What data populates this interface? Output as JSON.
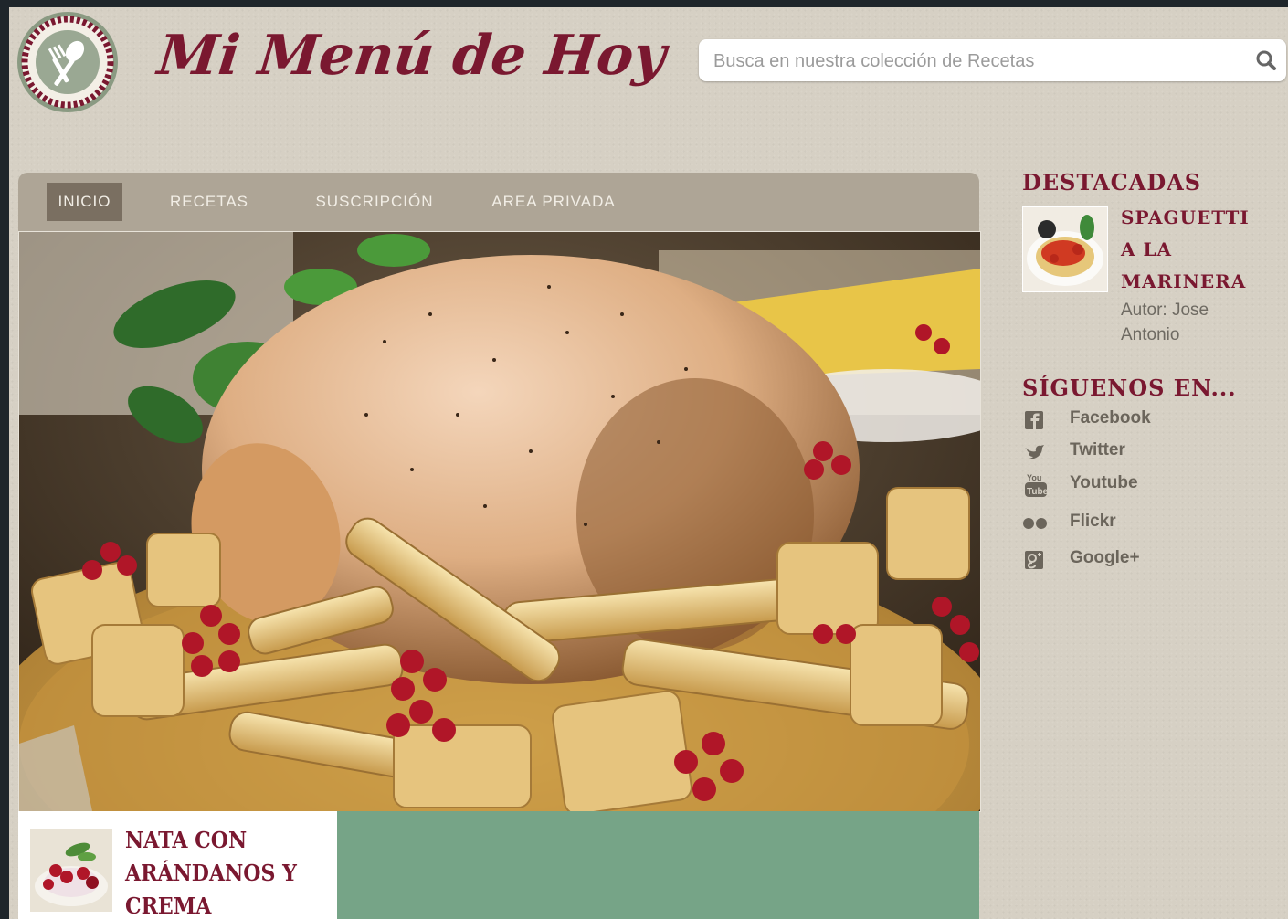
{
  "header": {
    "site_title": "Mi Menú de Hoy",
    "search": {
      "placeholder": "Busca en nuestra colección de Recetas",
      "value": ""
    }
  },
  "nav": {
    "items": [
      {
        "label": "INICIO",
        "active": true
      },
      {
        "label": "RECETAS",
        "active": false
      },
      {
        "label": "SUSCRIPCIÓN",
        "active": false
      },
      {
        "label": "AREA PRIVADA",
        "active": false
      }
    ]
  },
  "post_card": {
    "title": "NATA CON ARÁNDANOS Y CREMA"
  },
  "sidebar": {
    "featured": {
      "heading": "DESTACADAS",
      "title": "SPAGUETTI A LA MARINERA",
      "author": "Autor: Jose Antonio"
    },
    "social": {
      "heading": "SÍGUENOS EN...",
      "items": [
        {
          "label": "Facebook",
          "icon": "facebook-icon"
        },
        {
          "label": "Twitter",
          "icon": "twitter-icon"
        },
        {
          "label": "Youtube",
          "icon": "youtube-icon"
        },
        {
          "label": "Flickr",
          "icon": "flickr-icon"
        },
        {
          "label": "Google+",
          "icon": "google-plus-icon"
        }
      ]
    }
  },
  "colors": {
    "brand": "#7a1830",
    "nav_bg": "#aea596",
    "nav_active": "#7a6f61",
    "page_bg": "#d6d0c4",
    "green_panel": "#76a487"
  }
}
